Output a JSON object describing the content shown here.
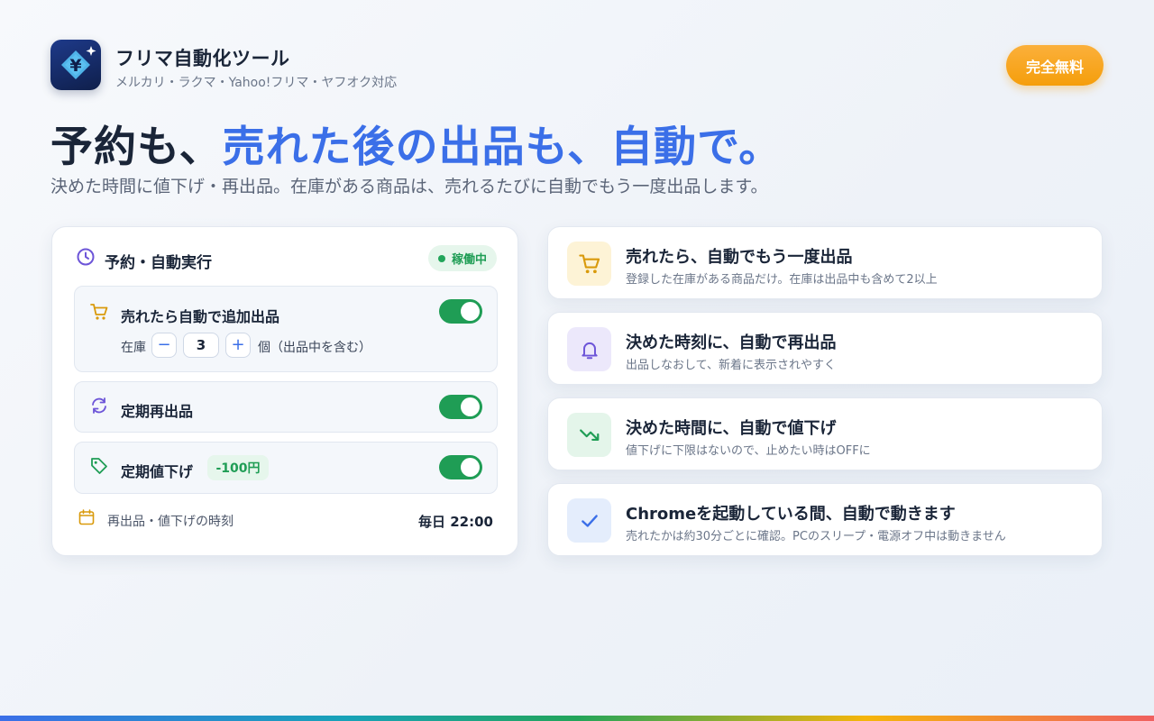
{
  "app": {
    "name": "フリマ自動化ツール",
    "subtitle": "メルカリ・ラクマ・Yahoo!フリマ・ヤフオク対応",
    "badge": "完全無料",
    "icon": "yen-sparkle-icon"
  },
  "hero": {
    "headline_part1": "予約も、",
    "headline_part2": "売れた後の出品も、自動で。",
    "subline": "決めた時間に値下げ・再出品。在庫がある商品は、売れるたびに自動でもう一度出品します。"
  },
  "panel": {
    "title": "予約・自動実行",
    "status": "稼働中",
    "rows": [
      {
        "label": "売れたら自動で追加出品",
        "icon": "cart-icon",
        "enabled": true,
        "stock_label": "在庫",
        "stock_value": "3",
        "stock_unit": "個（出品中を含む）",
        "minus": "−",
        "plus": "+"
      },
      {
        "label": "定期再出品",
        "icon": "refresh-icon",
        "enabled": true
      },
      {
        "label": "定期値下げ",
        "icon": "tag-icon",
        "enabled": true,
        "badge": "-100円"
      }
    ],
    "schedule": {
      "label": "再出品・値下げの時刻",
      "value": "毎日 22:00",
      "icon": "calendar-icon"
    }
  },
  "features": [
    {
      "title": "売れたら、自動でもう一度出品",
      "desc": "登録した在庫がある商品だけ。在庫は出品中も含めて2以上",
      "icon": "cart-icon",
      "bg": "#fdf3d6",
      "color": "#d99a0b"
    },
    {
      "title": "決めた時刻に、自動で再出品",
      "desc": "出品しなおして、新着に表示されやすく",
      "icon": "bell-icon",
      "bg": "#ece8fb",
      "color": "#6d55d8"
    },
    {
      "title": "決めた時間に、自動で値下げ",
      "desc": "値下げに下限はないので、止めたい時はOFFに",
      "icon": "trend-down-icon",
      "bg": "#e4f5ea",
      "color": "#1f9d55"
    },
    {
      "title": "Chromeを起動している間、自動で動きます",
      "desc": "売れたかは約30分ごとに確認。PCのスリープ・電源オフ中は動きません",
      "icon": "check-icon",
      "bg": "#e4edfc",
      "color": "#3b6fe8"
    }
  ],
  "colors": {
    "accent": "#3b6fe8",
    "success": "#1f9d55",
    "warning": "#f59e0b"
  }
}
